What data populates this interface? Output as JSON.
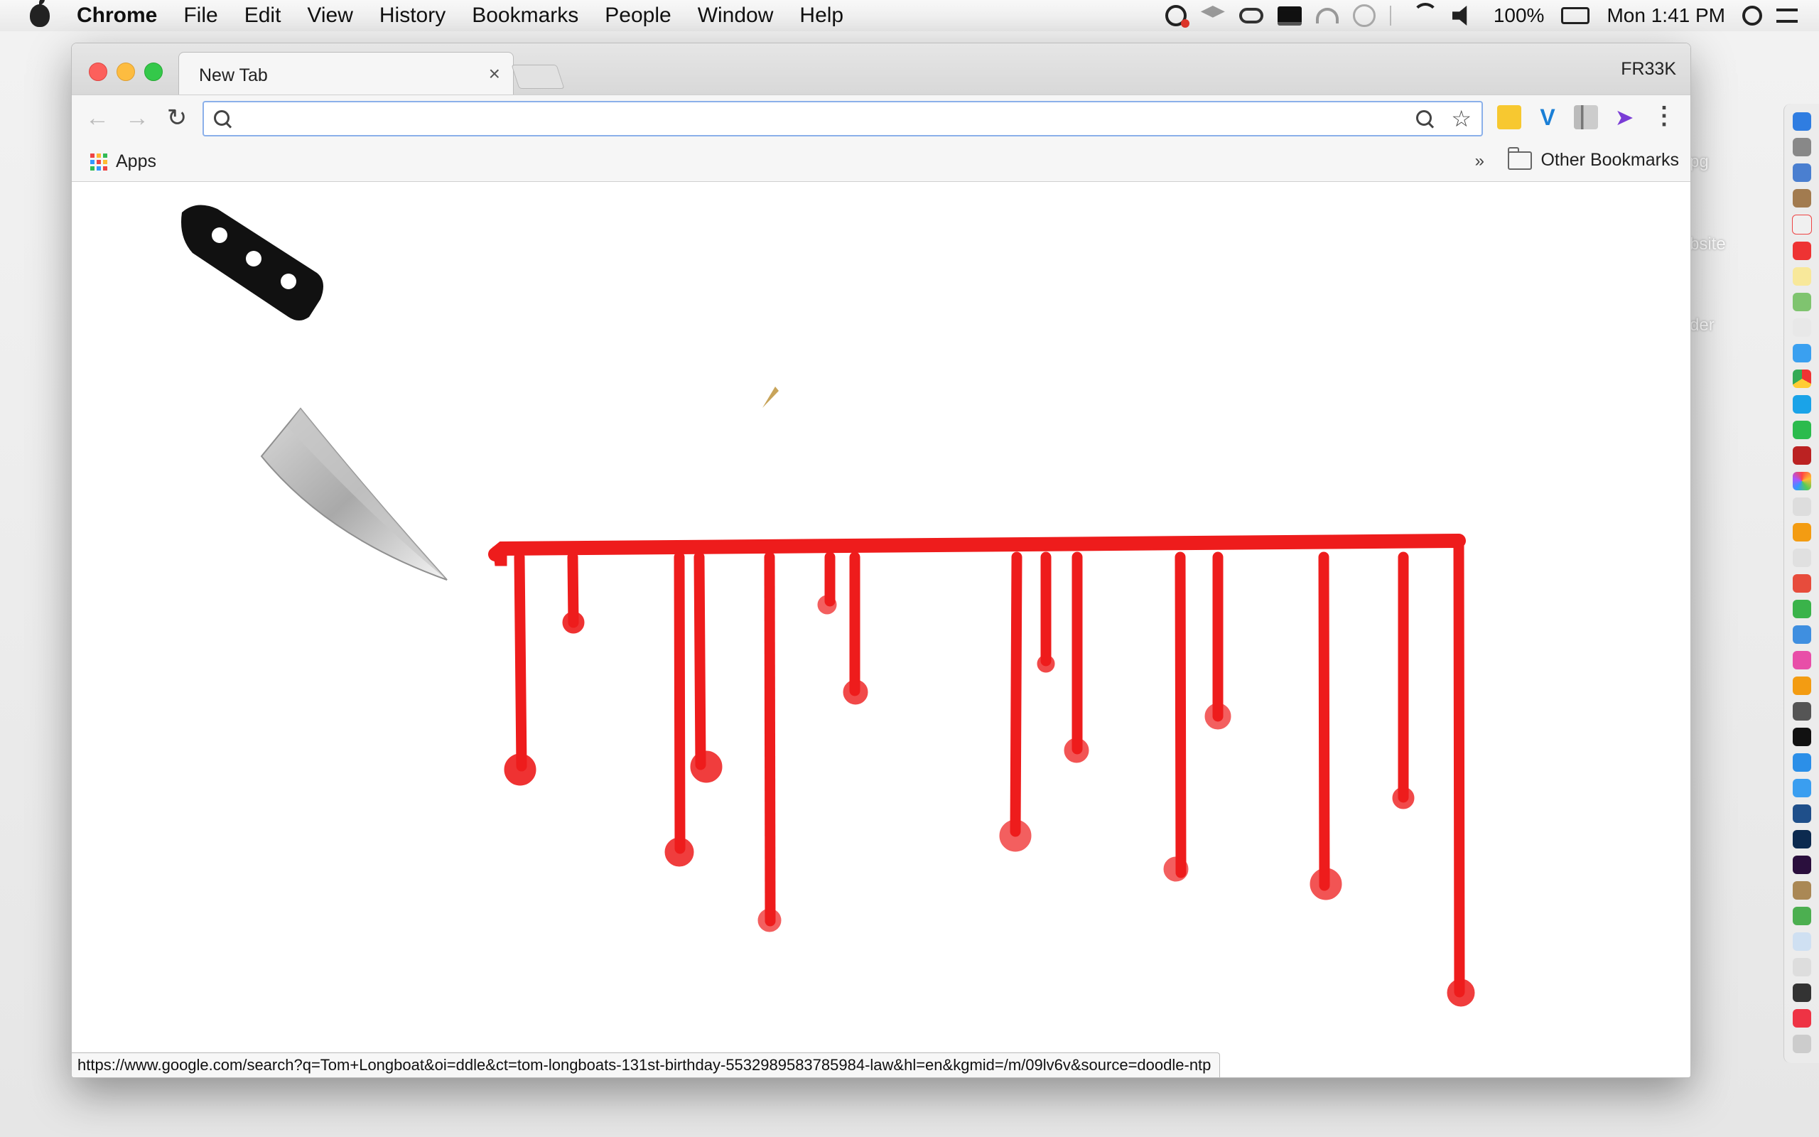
{
  "menubar": {
    "app_name": "Chrome",
    "menus": [
      "File",
      "Edit",
      "View",
      "History",
      "Bookmarks",
      "People",
      "Window",
      "Help"
    ],
    "battery": "100%",
    "clock": "Mon 1:41 PM",
    "status_icons": [
      "creative-cloud-icon",
      "dropbox-icon",
      "infinity-icon",
      "display-icon",
      "headphones-icon",
      "time-machine-icon",
      "bluetooth-icon",
      "wifi-icon",
      "volume-icon",
      "battery-icon",
      "spotlight-icon",
      "notification-center-icon"
    ]
  },
  "desktop": {
    "ghost_labels": [
      "pg",
      "bsite",
      "der"
    ]
  },
  "window": {
    "tab": {
      "title": "New Tab",
      "close_symbol": "×"
    },
    "profile_name": "FR33K",
    "toolbar": {
      "back_icon": "←",
      "forward_icon": "→",
      "reload_icon": "↻",
      "omnibox_value": "",
      "omnibox_placeholder": "",
      "star_icon": "☆",
      "menu_icon": "⋮",
      "extensions": [
        "lastpass-icon",
        "vimeo-icon",
        "gray-extension-icon",
        "cursor-extension-icon"
      ]
    },
    "bookmarks": {
      "apps_label": "Apps",
      "overflow_symbol": "»",
      "other_bookmarks_label": "Other Bookmarks"
    },
    "status_url": "https://www.google.com/search?q=Tom+Longboat&oi=ddle&ct=tom-longboats-131st-birthday-5532989583785984-law&hl=en&kgmid=/m/09lv6v&source=doodle-ntp"
  },
  "colors": {
    "blood": "#ee1c1c",
    "omnibox_focus": "#8bb0ea",
    "close": "#fc605c",
    "minimize": "#fdbc40",
    "maximize": "#34c84a"
  }
}
